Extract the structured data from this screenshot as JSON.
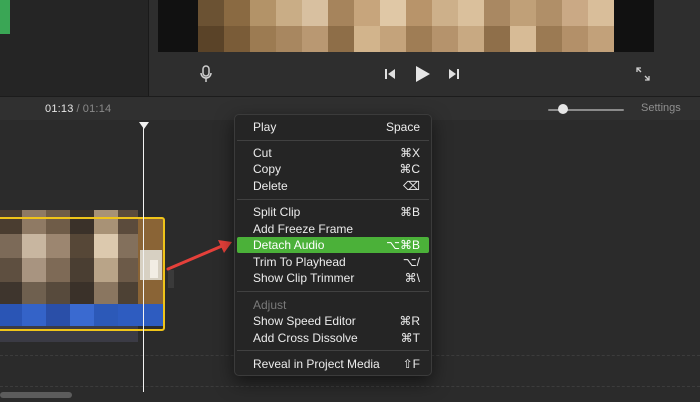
{
  "viewer": {
    "mic_icon": "microphone-icon",
    "prev_icon": "skip-back-icon",
    "play_icon": "play-icon",
    "next_icon": "skip-forward-icon",
    "fullscreen_icon": "fullscreen-icon"
  },
  "ruler": {
    "current_time": "01:13",
    "separator": "/",
    "total_time": "01:14",
    "settings_label": "Settings"
  },
  "context_menu": {
    "items": [
      {
        "label": "Play",
        "shortcut": "Space"
      },
      {
        "label": "Cut",
        "shortcut": "⌘X"
      },
      {
        "label": "Copy",
        "shortcut": "⌘C"
      },
      {
        "label": "Delete",
        "shortcut": "⌫"
      },
      {
        "label": "Split Clip",
        "shortcut": "⌘B"
      },
      {
        "label": "Add Freeze Frame",
        "shortcut": ""
      },
      {
        "label": "Detach Audio",
        "shortcut": "⌥⌘B"
      },
      {
        "label": "Trim To Playhead",
        "shortcut": "⌥/"
      },
      {
        "label": "Show Clip Trimmer",
        "shortcut": "⌘\\"
      },
      {
        "label": "Adjust",
        "shortcut": ""
      },
      {
        "label": "Show Speed Editor",
        "shortcut": "⌘R"
      },
      {
        "label": "Add Cross Dissolve",
        "shortcut": "⌘T"
      },
      {
        "label": "Reveal in Project Media",
        "shortcut": "⇧F"
      }
    ]
  },
  "colors": {
    "highlight": "#4bb139",
    "clip_border": "#f0c419",
    "annotation_arrow": "#e5403a",
    "audio_band": "#2e5cc0"
  }
}
